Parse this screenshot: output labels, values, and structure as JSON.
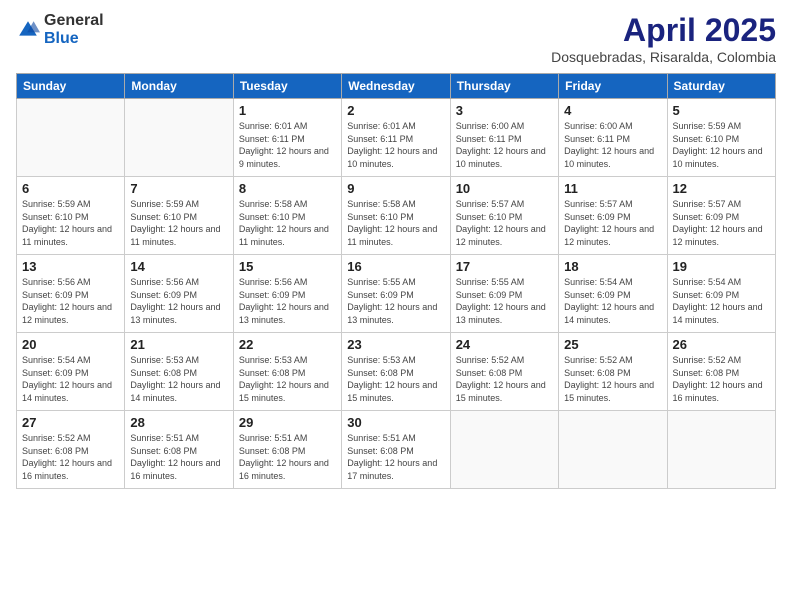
{
  "logo": {
    "general": "General",
    "blue": "Blue"
  },
  "title": "April 2025",
  "subtitle": "Dosquebradas, Risaralda, Colombia",
  "headers": [
    "Sunday",
    "Monday",
    "Tuesday",
    "Wednesday",
    "Thursday",
    "Friday",
    "Saturday"
  ],
  "weeks": [
    [
      {
        "day": "",
        "info": ""
      },
      {
        "day": "",
        "info": ""
      },
      {
        "day": "1",
        "info": "Sunrise: 6:01 AM\nSunset: 6:11 PM\nDaylight: 12 hours and 9 minutes."
      },
      {
        "day": "2",
        "info": "Sunrise: 6:01 AM\nSunset: 6:11 PM\nDaylight: 12 hours and 10 minutes."
      },
      {
        "day": "3",
        "info": "Sunrise: 6:00 AM\nSunset: 6:11 PM\nDaylight: 12 hours and 10 minutes."
      },
      {
        "day": "4",
        "info": "Sunrise: 6:00 AM\nSunset: 6:11 PM\nDaylight: 12 hours and 10 minutes."
      },
      {
        "day": "5",
        "info": "Sunrise: 5:59 AM\nSunset: 6:10 PM\nDaylight: 12 hours and 10 minutes."
      }
    ],
    [
      {
        "day": "6",
        "info": "Sunrise: 5:59 AM\nSunset: 6:10 PM\nDaylight: 12 hours and 11 minutes."
      },
      {
        "day": "7",
        "info": "Sunrise: 5:59 AM\nSunset: 6:10 PM\nDaylight: 12 hours and 11 minutes."
      },
      {
        "day": "8",
        "info": "Sunrise: 5:58 AM\nSunset: 6:10 PM\nDaylight: 12 hours and 11 minutes."
      },
      {
        "day": "9",
        "info": "Sunrise: 5:58 AM\nSunset: 6:10 PM\nDaylight: 12 hours and 11 minutes."
      },
      {
        "day": "10",
        "info": "Sunrise: 5:57 AM\nSunset: 6:10 PM\nDaylight: 12 hours and 12 minutes."
      },
      {
        "day": "11",
        "info": "Sunrise: 5:57 AM\nSunset: 6:09 PM\nDaylight: 12 hours and 12 minutes."
      },
      {
        "day": "12",
        "info": "Sunrise: 5:57 AM\nSunset: 6:09 PM\nDaylight: 12 hours and 12 minutes."
      }
    ],
    [
      {
        "day": "13",
        "info": "Sunrise: 5:56 AM\nSunset: 6:09 PM\nDaylight: 12 hours and 12 minutes."
      },
      {
        "day": "14",
        "info": "Sunrise: 5:56 AM\nSunset: 6:09 PM\nDaylight: 12 hours and 13 minutes."
      },
      {
        "day": "15",
        "info": "Sunrise: 5:56 AM\nSunset: 6:09 PM\nDaylight: 12 hours and 13 minutes."
      },
      {
        "day": "16",
        "info": "Sunrise: 5:55 AM\nSunset: 6:09 PM\nDaylight: 12 hours and 13 minutes."
      },
      {
        "day": "17",
        "info": "Sunrise: 5:55 AM\nSunset: 6:09 PM\nDaylight: 12 hours and 13 minutes."
      },
      {
        "day": "18",
        "info": "Sunrise: 5:54 AM\nSunset: 6:09 PM\nDaylight: 12 hours and 14 minutes."
      },
      {
        "day": "19",
        "info": "Sunrise: 5:54 AM\nSunset: 6:09 PM\nDaylight: 12 hours and 14 minutes."
      }
    ],
    [
      {
        "day": "20",
        "info": "Sunrise: 5:54 AM\nSunset: 6:09 PM\nDaylight: 12 hours and 14 minutes."
      },
      {
        "day": "21",
        "info": "Sunrise: 5:53 AM\nSunset: 6:08 PM\nDaylight: 12 hours and 14 minutes."
      },
      {
        "day": "22",
        "info": "Sunrise: 5:53 AM\nSunset: 6:08 PM\nDaylight: 12 hours and 15 minutes."
      },
      {
        "day": "23",
        "info": "Sunrise: 5:53 AM\nSunset: 6:08 PM\nDaylight: 12 hours and 15 minutes."
      },
      {
        "day": "24",
        "info": "Sunrise: 5:52 AM\nSunset: 6:08 PM\nDaylight: 12 hours and 15 minutes."
      },
      {
        "day": "25",
        "info": "Sunrise: 5:52 AM\nSunset: 6:08 PM\nDaylight: 12 hours and 15 minutes."
      },
      {
        "day": "26",
        "info": "Sunrise: 5:52 AM\nSunset: 6:08 PM\nDaylight: 12 hours and 16 minutes."
      }
    ],
    [
      {
        "day": "27",
        "info": "Sunrise: 5:52 AM\nSunset: 6:08 PM\nDaylight: 12 hours and 16 minutes."
      },
      {
        "day": "28",
        "info": "Sunrise: 5:51 AM\nSunset: 6:08 PM\nDaylight: 12 hours and 16 minutes."
      },
      {
        "day": "29",
        "info": "Sunrise: 5:51 AM\nSunset: 6:08 PM\nDaylight: 12 hours and 16 minutes."
      },
      {
        "day": "30",
        "info": "Sunrise: 5:51 AM\nSunset: 6:08 PM\nDaylight: 12 hours and 17 minutes."
      },
      {
        "day": "",
        "info": ""
      },
      {
        "day": "",
        "info": ""
      },
      {
        "day": "",
        "info": ""
      }
    ]
  ]
}
